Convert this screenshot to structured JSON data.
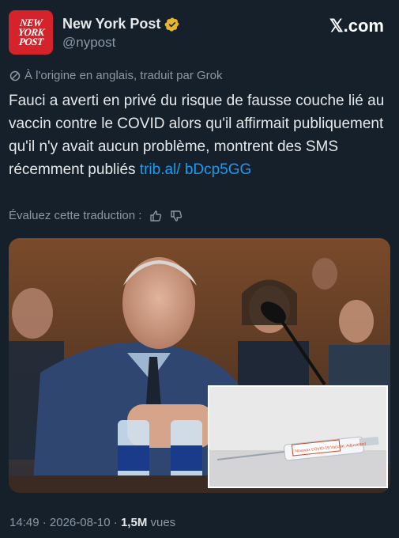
{
  "account": {
    "avatar_text": [
      "NEW",
      "YORK",
      "POST"
    ],
    "name": "New York Post",
    "handle": "@nypost",
    "verified_icon": "verified-badge-icon",
    "verified_color": "#e8b62b"
  },
  "brand": {
    "label": "𝕏.com"
  },
  "translation_note": "À l'origine en anglais, traduit par Grok",
  "tweet": {
    "text": "Fauci a averti en privé du risque de fausse couche lié au vaccin contre le COVID alors qu'il affirmait publiquement qu'il n'y avait aucun problème, montrent des SMS récemment publiés ",
    "link": "trib.al/ bDcp5GG"
  },
  "rate_translation": {
    "label": "Évaluez cette traduction :",
    "thumbs_up_icon": "thumbs-up-icon",
    "thumbs_down_icon": "thumbs-down-icon"
  },
  "media": {
    "inset_syringe_label": "Novavax COVID-19 Vaccine, Adjuvanted"
  },
  "footer": {
    "time": "14:49",
    "date": "2026-08-10",
    "views_count": "1,5M",
    "views_label": "vues"
  },
  "colors": {
    "background": "#15202b",
    "link": "#1d9bf0",
    "muted": "#8b98a5"
  }
}
